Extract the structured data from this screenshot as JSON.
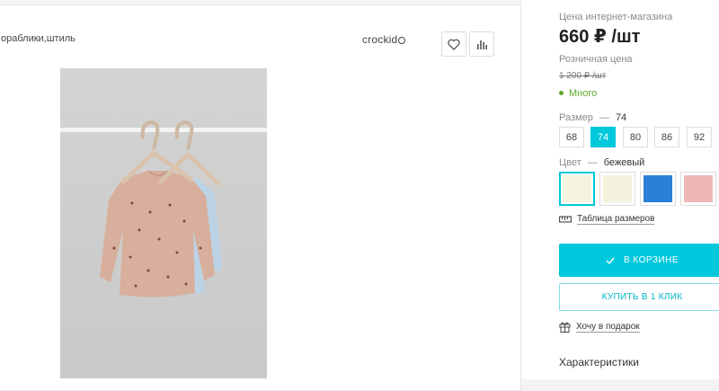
{
  "product": {
    "title_fragment": "ораблики,штиль",
    "brand": "crockid",
    "photo_alt_colors": [
      "#d8af9c",
      "#bcd3e6"
    ]
  },
  "actions": {
    "favorite_icon": "heart-icon",
    "compare_icon": "bar-chart-icon"
  },
  "pricing": {
    "online_label": "Цена интернет-магазина",
    "online_price": "660 ₽ /шт",
    "retail_label": "Розничная цена",
    "retail_price": "1 200 ₽ /шт"
  },
  "stock": {
    "text": "Много",
    "color": "#5fa82a"
  },
  "size": {
    "label": "Размер",
    "dash": "—",
    "selected": "74",
    "options": [
      "68",
      "74",
      "80",
      "86",
      "92"
    ],
    "active_index": 1
  },
  "color": {
    "label": "Цвет",
    "dash": "—",
    "selected": "бежевый",
    "swatches": [
      "#f5f3dd",
      "#f4f2dc",
      "#2a80d6",
      "#efb8b8"
    ],
    "selected_index": 0
  },
  "size_table_label": "Таблица размеров",
  "cart_button_label": "В КОРЗИНЕ",
  "buy_one_click_label": "КУПИТЬ В 1 КЛИК",
  "gift_label": "Хочу в подарок",
  "features_label": "Характеристики",
  "accent_color": "#00c8dc"
}
